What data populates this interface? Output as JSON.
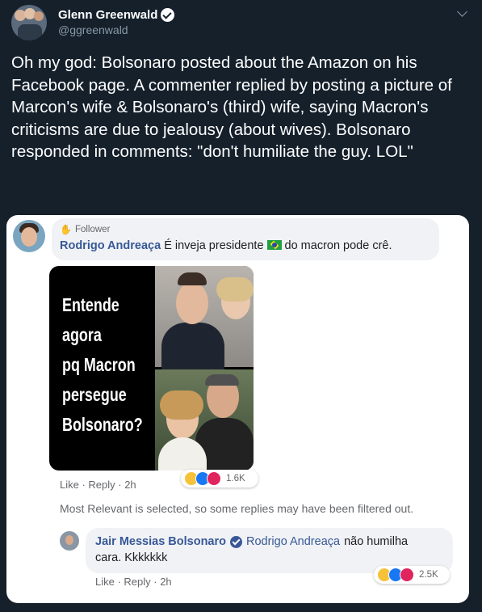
{
  "tweet": {
    "display_name": "Glenn Greenwald",
    "handle": "@ggreenwald",
    "text": "Oh my god: Bolsonaro posted about the Amazon on his Facebook page. A commenter replied by posting a picture of Marcon's wife & Bolsonaro's (third) wife, saying Macron's criticisms are due to jealousy (about wives). Bolsonaro responded in comments: \"don't humiliate the guy. LOL\""
  },
  "fb_comment1": {
    "badge": "Follower",
    "author": "Rodrigo Andreaça",
    "text_before_flag": "É inveja presidente",
    "text_after_flag": "do macron pode crê.",
    "actions": "Like · Reply · 2h",
    "reaction_count": "1.6K"
  },
  "meme": {
    "text": "Entende\nagora\npq Macron\npersegue\nBolsonaro?"
  },
  "filter_note": "Most Relevant is selected, so some replies may have been filtered out.",
  "fb_reply": {
    "author": "Jair Messias Bolsonaro",
    "mention": "Rodrigo Andreaça",
    "text_line1": "não humilha",
    "text_line2": "cara. Kkkkkkk",
    "actions": "Like · Reply · 2h",
    "reaction_count": "2.5K"
  }
}
